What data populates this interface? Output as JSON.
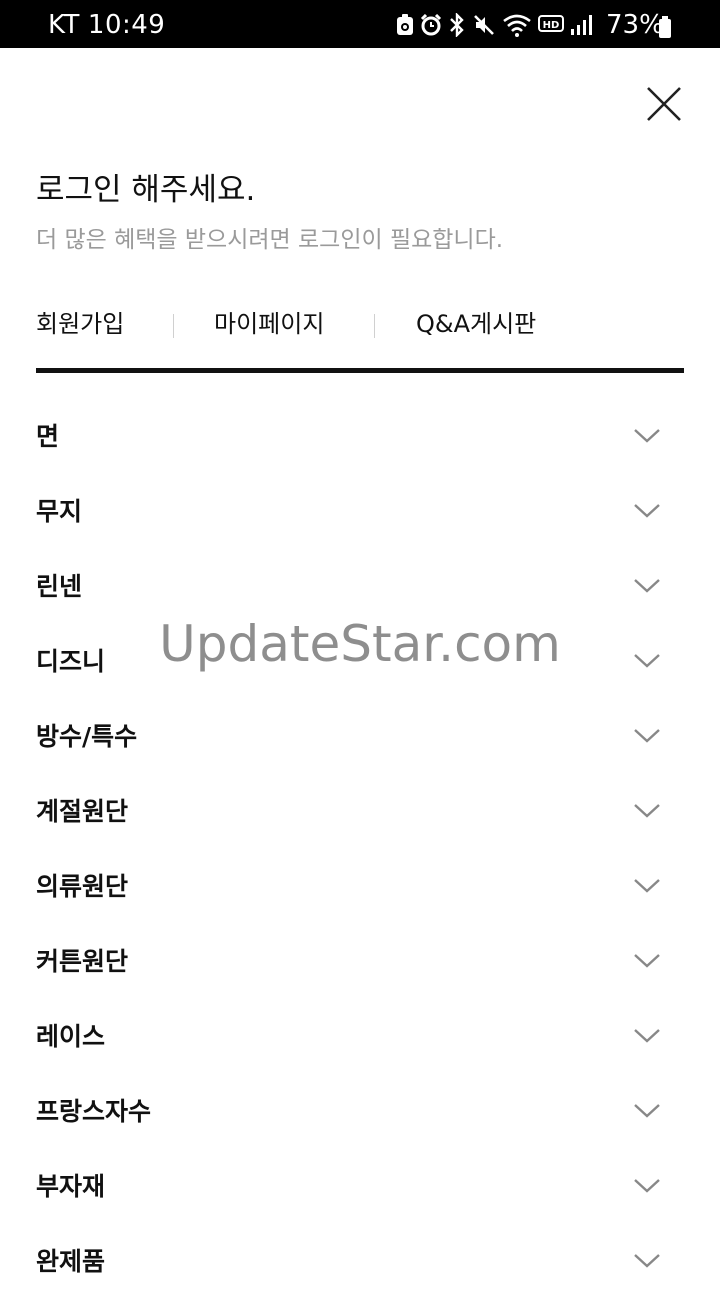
{
  "status_bar": {
    "carrier": "KT",
    "time": "10:49",
    "battery_percent": "73%",
    "icons": [
      "alert-icon",
      "alarm-icon",
      "bluetooth-icon",
      "mute-icon",
      "wifi-icon",
      "hd-icon",
      "signal-icon",
      "battery-icon"
    ]
  },
  "header": {
    "close_icon": "close-icon",
    "title": "로그인 해주세요.",
    "subtitle": "더 많은 혜택을 받으시려면 로그인이 필요합니다."
  },
  "quick_links": [
    {
      "label": "회원가입"
    },
    {
      "label": "마이페이지"
    },
    {
      "label": "Q&A게시판"
    }
  ],
  "menu": [
    {
      "label": "면",
      "icon": "chevron-down-icon"
    },
    {
      "label": "무지",
      "icon": "chevron-down-icon"
    },
    {
      "label": "린넨",
      "icon": "chevron-down-icon"
    },
    {
      "label": "디즈니",
      "icon": "chevron-down-icon"
    },
    {
      "label": "방수/특수",
      "icon": "chevron-down-icon"
    },
    {
      "label": "계절원단",
      "icon": "chevron-down-icon"
    },
    {
      "label": "의류원단",
      "icon": "chevron-down-icon"
    },
    {
      "label": "커튼원단",
      "icon": "chevron-down-icon"
    },
    {
      "label": "레이스",
      "icon": "chevron-down-icon"
    },
    {
      "label": "프랑스자수",
      "icon": "chevron-down-icon"
    },
    {
      "label": "부자재",
      "icon": "chevron-down-icon"
    },
    {
      "label": "완제품",
      "icon": "chevron-down-icon"
    }
  ],
  "watermark": "UpdateStar.com",
  "colors": {
    "status_bar_bg": "#000000",
    "text_primary": "#111111",
    "text_secondary": "#9a9a9a",
    "divider": "#111111"
  }
}
